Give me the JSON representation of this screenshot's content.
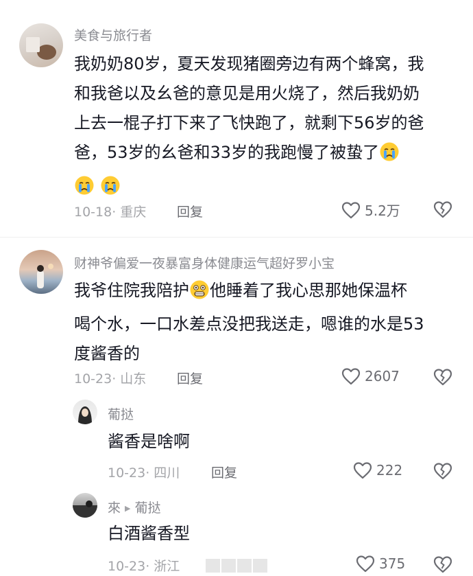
{
  "comments": [
    {
      "username": "美食与旅行者",
      "text_lines": [
        "我奶奶80岁，夏天发现猪圈旁边有两个蜂窝，我",
        "和我爸以及幺爸的意见是用火烧了，然后我奶奶",
        "上去一棍子打下来了飞快跑了，就剩下56岁的爸",
        "爸，53岁的幺爸和33岁的我跑慢了被蛰了"
      ],
      "date_location": "10-18· 重庆",
      "reply_label": "回复",
      "likes": "5.2万",
      "emojis": [
        "crying-face",
        "crying-face",
        "crying-face"
      ]
    },
    {
      "username": "财神爷偏爱一夜暴富身体健康运气超好罗小宝",
      "text_part1": "我爷住院我陪护",
      "text_part2": "他睡着了我心思那她保温杯",
      "text_lines": [
        "喝个水，一口水差点没把我送走，嗯谁的水是53",
        "度酱香的"
      ],
      "date_location": "10-23· 山东",
      "reply_label": "回复",
      "likes": "2607",
      "emojis": [
        "grimacing-face"
      ]
    }
  ],
  "replies": [
    {
      "username": "葡挞",
      "text": "酱香是啥啊",
      "date_location": "10-23· 四川",
      "reply_label": "回复",
      "likes": "222"
    },
    {
      "username": "來",
      "reply_to": "葡挞",
      "text": "白酒酱香型",
      "date_location": "10-23· 浙江",
      "likes": "375"
    }
  ],
  "icons": {
    "like": "heart-outline-icon",
    "dislike": "broken-heart-icon",
    "reply_arrow": "triangle-right-icon"
  }
}
